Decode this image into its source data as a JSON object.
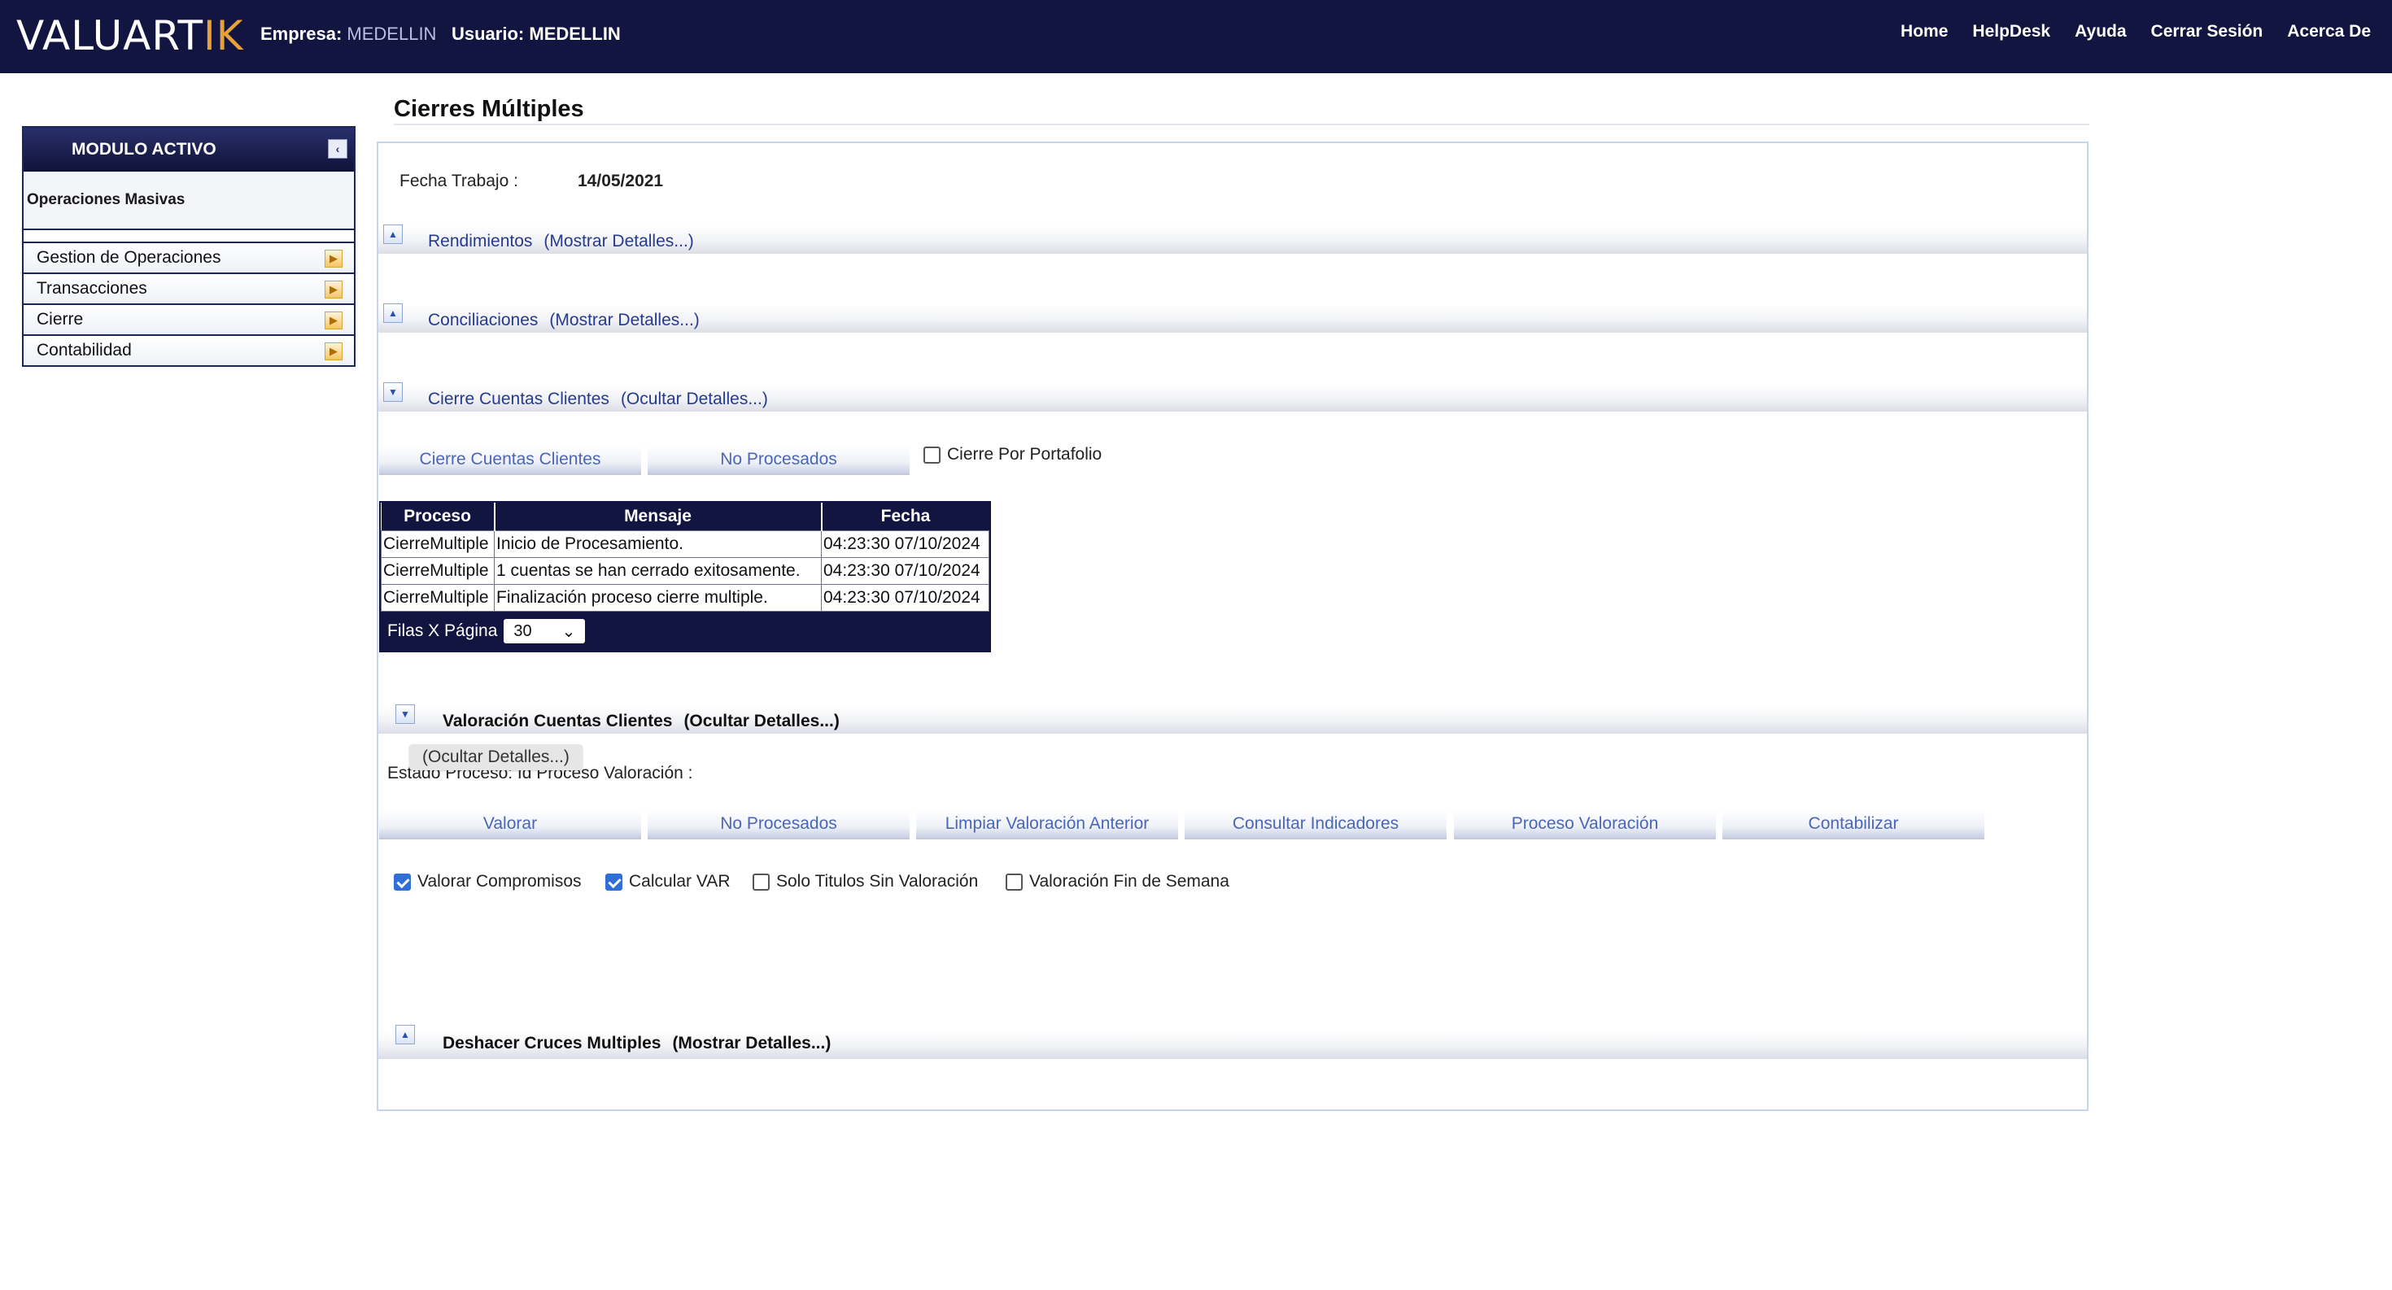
{
  "header": {
    "logo_main": "VALUART",
    "logo_accent": "IK",
    "company_label": "Empresa:",
    "company_value": "MEDELLIN",
    "user_label": "Usuario:",
    "user_value": "MEDELLIN",
    "nav": [
      "Home",
      "HelpDesk",
      "Ayuda",
      "Cerrar Sesión",
      "Acerca De"
    ]
  },
  "sidebar": {
    "title": "MODULO ACTIVO",
    "module": "Operaciones Masivas",
    "items": [
      "Gestion de Operaciones",
      "Transacciones",
      "Cierre",
      "Contabilidad"
    ]
  },
  "page": {
    "title": "Cierres Múltiples",
    "fecha_label": "Fecha Trabajo :",
    "fecha_value": "14/05/2021"
  },
  "sections": {
    "rendimientos": {
      "title": "Rendimientos",
      "details": "(Mostrar Detalles...)"
    },
    "conciliaciones": {
      "title": "Conciliaciones",
      "details": "(Mostrar Detalles...)"
    },
    "cierre_cuentas": {
      "title": "Cierre Cuentas Clientes",
      "details": "(Ocultar Detalles...)",
      "btn_cierre": "Cierre Cuentas Clientes",
      "btn_no_procesados": "No Procesados",
      "chk_portafolio": "Cierre Por Portafolio"
    },
    "valoracion": {
      "title": "Valoración Cuentas Clientes",
      "details": "(Ocultar Detalles...)",
      "tooltip": "(Ocultar Detalles...)",
      "estado": "Estado Proceso:  Id Proceso Valoración :",
      "buttons": [
        "Valorar",
        "No Procesados",
        "Limpiar Valoración Anterior",
        "Consultar Indicadores",
        "Proceso Valoración",
        "Contabilizar"
      ],
      "checks": [
        {
          "label": "Valorar Compromisos",
          "checked": true
        },
        {
          "label": "Calcular VAR",
          "checked": true
        },
        {
          "label": "Solo Titulos Sin Valoración",
          "checked": false
        },
        {
          "label": "Valoración Fin de Semana",
          "checked": false
        }
      ]
    },
    "deshacer": {
      "title": "Deshacer Cruces Multiples",
      "details": "(Mostrar Detalles...)"
    }
  },
  "grid": {
    "headers": [
      "Proceso",
      "Mensaje",
      "Fecha"
    ],
    "rows": [
      [
        "CierreMultiple",
        "Inicio de Procesamiento.",
        "04:23:30 07/10/2024"
      ],
      [
        "CierreMultiple",
        "1 cuentas se han cerrado exitosamente.",
        "04:23:30 07/10/2024"
      ],
      [
        "CierreMultiple",
        "Finalización proceso cierre multiple.",
        "04:23:30 07/10/2024"
      ]
    ],
    "rows_per_page_label": "Filas X Página",
    "rows_per_page_value": "30"
  },
  "icons": {
    "collapse": "collapse-icon",
    "expand_arrow": "chevron-right-icon",
    "toggle_up": "arrow-up-icon",
    "toggle_down": "arrow-down-icon"
  },
  "colors": {
    "header_bg": "#111540",
    "accent": "#e8a23a",
    "link": "#263a8f",
    "button_text": "#4b66b8"
  }
}
